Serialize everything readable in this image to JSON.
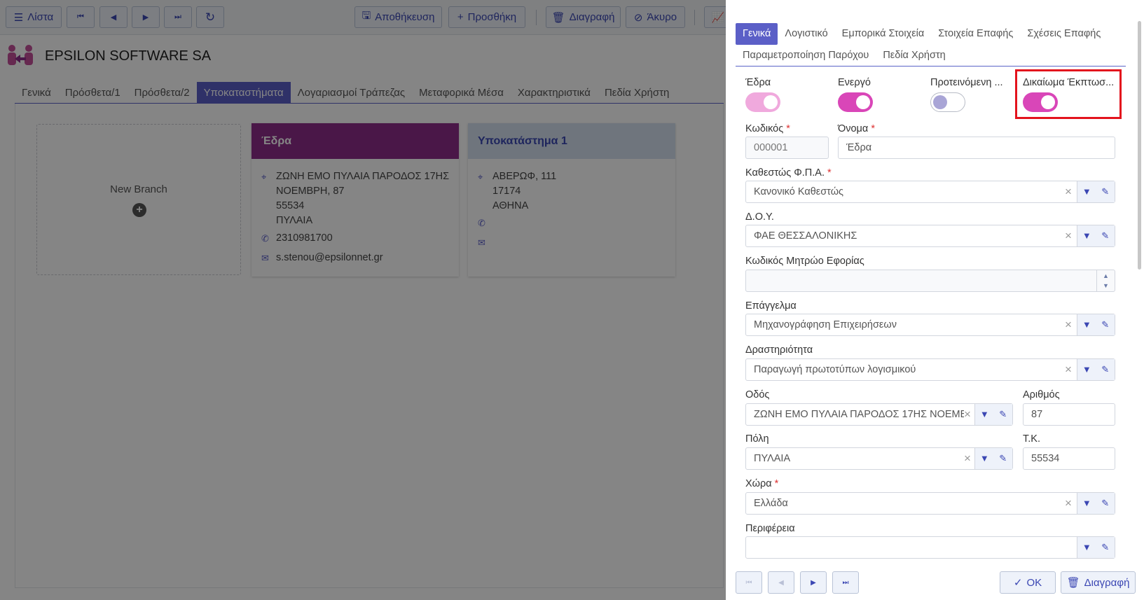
{
  "toolbar": {
    "list_label": "Λίστα",
    "save_label": "Αποθήκευση",
    "add_label": "Προσθήκη",
    "delete_label": "Διαγραφή",
    "cancel_label": "Άκυρο"
  },
  "company": {
    "name": "EPSILON SOFTWARE SA"
  },
  "main_tabs": [
    "Γενικά",
    "Πρόσθετα/1",
    "Πρόσθετα/2",
    "Υποκαταστήματα",
    "Λογαριασμοί Τράπεζας",
    "Μεταφορικά Μέσα",
    "Χαρακτηριστικά",
    "Πεδία Χρήστη"
  ],
  "main_tab_active": "Υποκαταστήματα",
  "new_branch_label": "New Branch",
  "branches": [
    {
      "title": "Έδρα",
      "address_lines": [
        "ΖΩΝΗ ΕΜΟ ΠΥΛΑΙΑ ΠΑΡΟΔΟΣ 17ΗΣ",
        "ΝΟΕΜΒΡΗ, 87",
        "55534",
        "ΠΥΛΑΙΑ"
      ],
      "phone": "2310981700",
      "email": "s.stenou@epsilonnet.gr"
    },
    {
      "title": "Υποκατάστημα 1",
      "address_lines": [
        "ΑΒΕΡΩΦ, 111",
        "17174",
        "ΑΘΗΝΑ"
      ],
      "phone": "",
      "email": ""
    }
  ],
  "panel": {
    "tabs_row1": [
      "Γενικά",
      "Λογιστικό",
      "Εμπορικά Στοιχεία",
      "Στοιχεία Επαφής",
      "Σχέσεις Επαφής"
    ],
    "tabs_row2": [
      "Παραμετροποίηση Παρόχου",
      "Πεδία Χρήστη"
    ],
    "active_tab": "Γενικά",
    "toggles": {
      "edra": {
        "label": "Έδρα",
        "on": true
      },
      "energo": {
        "label": "Ενεργό",
        "on": true
      },
      "proteinomeni": {
        "label": "Προτεινόμενη ...",
        "on": false
      },
      "dikaioma": {
        "label": "Δικαίωμα Έκπτωσ...",
        "on": true
      }
    },
    "fields": {
      "kodikos": {
        "label": "Κωδικός",
        "value": "000001"
      },
      "onoma": {
        "label": "Όνομα",
        "value": "Έδρα"
      },
      "fpa": {
        "label": "Καθεστώς Φ.Π.Α.",
        "value": "Κανονικό Καθεστώς"
      },
      "doy": {
        "label": "Δ.Ο.Υ.",
        "value": "ΦΑΕ ΘΕΣΣΑΛΟΝΙΚΗΣ"
      },
      "mitroo": {
        "label": "Κωδικός Μητρώο Εφορίας",
        "value": ""
      },
      "epaggelma": {
        "label": "Επάγγελμα",
        "value": "Μηχανογράφηση Επιχειρήσεων"
      },
      "drastiriotita": {
        "label": "Δραστηριότητα",
        "value": "Παραγωγή πρωτοτύπων λογισμικού"
      },
      "odos": {
        "label": "Οδός",
        "value": "ΖΩΝΗ ΕΜΟ ΠΥΛΑΙΑ ΠΑΡΟΔΟΣ 17ΗΣ ΝΟΕΜΒ..."
      },
      "arithmos": {
        "label": "Αριθμός",
        "value": "87"
      },
      "poli": {
        "label": "Πόλη",
        "value": "ΠΥΛΑΙΑ"
      },
      "tk": {
        "label": "Τ.Κ.",
        "value": "55534"
      },
      "xora": {
        "label": "Χώρα",
        "value": "Ελλάδα"
      },
      "perifereia": {
        "label": "Περιφέρεια",
        "value": ""
      }
    },
    "ok_label": "OK",
    "delete_label": "Διαγραφή"
  },
  "colors": {
    "accent": "#5b5fc7",
    "brand": "#8e2c8a",
    "toggle_on": "#d946b8",
    "highlight": "#e3131d"
  }
}
